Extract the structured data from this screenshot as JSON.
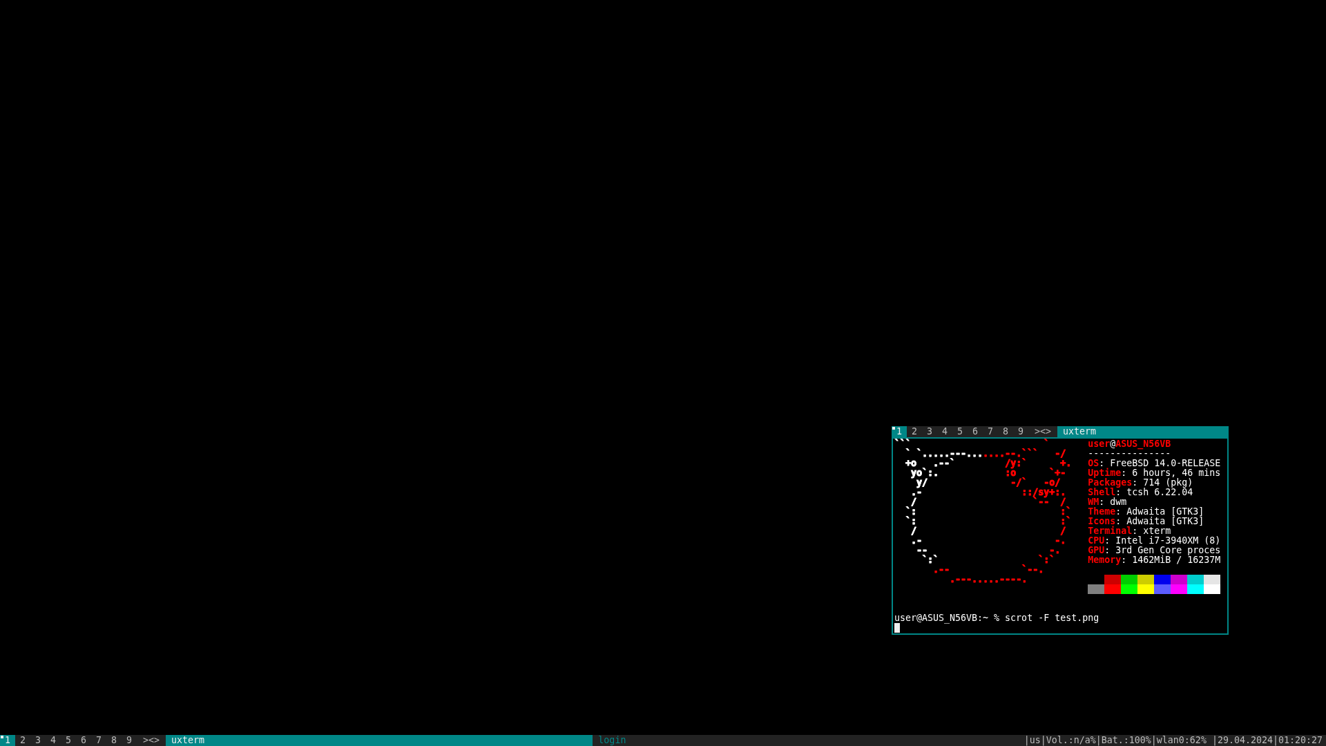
{
  "terminal_window": {
    "bar": {
      "tags": [
        {
          "label": "1",
          "selected": true,
          "occupied": true
        },
        {
          "label": "2",
          "selected": false,
          "occupied": false
        },
        {
          "label": "3",
          "selected": false,
          "occupied": false
        },
        {
          "label": "4",
          "selected": false,
          "occupied": false
        },
        {
          "label": "5",
          "selected": false,
          "occupied": false
        },
        {
          "label": "6",
          "selected": false,
          "occupied": false
        },
        {
          "label": "7",
          "selected": false,
          "occupied": false
        },
        {
          "label": "8",
          "selected": false,
          "occupied": false
        },
        {
          "label": "9",
          "selected": false,
          "occupied": false
        }
      ],
      "layout_symbol": "><>",
      "windows": [
        {
          "title": "uxterm",
          "selected": true,
          "hidden": false
        }
      ]
    },
    "logo": {
      "lines": [
        [
          {
            "text": "```",
            "color": "#ffffff"
          },
          {
            "text": "                        `",
            "color": "#ff0000"
          }
        ],
        [
          {
            "text": "  ` `.....---...",
            "color": "#ffffff"
          },
          {
            "text": "....--.```   -/",
            "color": "#ff0000"
          }
        ],
        [
          {
            "text": "  +o   .--`",
            "color": "#ffffff"
          },
          {
            "text": "         /y:`      +.",
            "color": "#ff0000"
          }
        ],
        [
          {
            "text": "   yo`:.",
            "color": "#ffffff"
          },
          {
            "text": "            :o      `+-",
            "color": "#ff0000"
          }
        ],
        [
          {
            "text": "    y/",
            "color": "#ffffff"
          },
          {
            "text": "               -/`   -o/",
            "color": "#ff0000"
          }
        ],
        [
          {
            "text": "   .-",
            "color": "#ffffff"
          },
          {
            "text": "                  ::/sy+:.",
            "color": "#ff0000"
          }
        ],
        [
          {
            "text": "   /",
            "color": "#ffffff"
          },
          {
            "text": "                     `--  /",
            "color": "#ff0000"
          }
        ],
        [
          {
            "text": "  `:",
            "color": "#ffffff"
          },
          {
            "text": "                          :`",
            "color": "#ff0000"
          }
        ],
        [
          {
            "text": "  `:",
            "color": "#ffffff"
          },
          {
            "text": "                          :`",
            "color": "#ff0000"
          }
        ],
        [
          {
            "text": "   /",
            "color": "#ffffff"
          },
          {
            "text": "                          /",
            "color": "#ff0000"
          }
        ],
        [
          {
            "text": "   .-",
            "color": "#ffffff"
          },
          {
            "text": "                        -.",
            "color": "#ff0000"
          }
        ],
        [
          {
            "text": "    --",
            "color": "#ffffff"
          },
          {
            "text": "                      -.",
            "color": "#ff0000"
          }
        ],
        [
          {
            "text": "     `:`",
            "color": "#ffffff"
          },
          {
            "text": "                  `:`",
            "color": "#ff0000"
          }
        ],
        [
          {
            "text": "       .--             `--.",
            "color": "#ff0000"
          }
        ],
        [
          {
            "text": "          .---.....----.",
            "color": "#ff0000"
          }
        ]
      ]
    },
    "info": {
      "user": "user",
      "at": "@",
      "host": "ASUS_N56VB",
      "underline": "---------------",
      "fields": [
        {
          "label": "OS",
          "separator": ":",
          "value": "FreeBSD 14.0-RELEASE"
        },
        {
          "label": "Uptime",
          "separator": ":",
          "value": "6 hours, 46 mins"
        },
        {
          "label": "Packages",
          "separator": ":",
          "value": "714 (pkg)"
        },
        {
          "label": "Shell",
          "separator": ":",
          "value": "tcsh 6.22.04"
        },
        {
          "label": "WM",
          "separator": ":",
          "value": "dwm"
        },
        {
          "label": "Theme",
          "separator": ":",
          "value": "Adwaita [GTK3]"
        },
        {
          "label": "Icons",
          "separator": ":",
          "value": "Adwaita [GTK3]"
        },
        {
          "label": "Terminal",
          "separator": ":",
          "value": "xterm"
        },
        {
          "label": "CPU",
          "separator": ":",
          "value": "Intel i7-3940XM (8)"
        },
        {
          "label": "GPU",
          "separator": ":",
          "value": "3rd Gen Core proces"
        },
        {
          "label": "Memory",
          "separator": ":",
          "value": "1462MiB / 16237M"
        }
      ]
    },
    "palette": {
      "rows": [
        [
          {
            "color": "#cd0000"
          },
          {
            "color": "#00cd00"
          },
          {
            "color": "#cdcd00"
          },
          {
            "color": "#0000ee"
          },
          {
            "color": "#cd00cd"
          },
          {
            "color": "#00cdcd"
          },
          {
            "color": "#e5e5e5"
          }
        ],
        [
          {
            "color": "#7f7f7f"
          },
          {
            "color": "#ff0000"
          },
          {
            "color": "#00ff00"
          },
          {
            "color": "#ffff00"
          },
          {
            "color": "#5c5cff"
          },
          {
            "color": "#ff00ff"
          },
          {
            "color": "#00ffff"
          },
          {
            "color": "#ffffff"
          }
        ]
      ]
    },
    "prompt": "user@ASUS_N56VB:~ % scrot -F test.png"
  },
  "bar": {
    "tags": [
      {
        "label": "1",
        "selected": true,
        "occupied": true
      },
      {
        "label": "2",
        "selected": false,
        "occupied": false
      },
      {
        "label": "3",
        "selected": false,
        "occupied": false
      },
      {
        "label": "4",
        "selected": false,
        "occupied": false
      },
      {
        "label": "5",
        "selected": false,
        "occupied": false
      },
      {
        "label": "6",
        "selected": false,
        "occupied": false
      },
      {
        "label": "7",
        "selected": false,
        "occupied": false
      },
      {
        "label": "8",
        "selected": false,
        "occupied": false
      },
      {
        "label": "9",
        "selected": false,
        "occupied": false
      }
    ],
    "layout_symbol": "><>",
    "windows": [
      {
        "title": "uxterm",
        "selected": true,
        "hidden": false
      },
      {
        "title": "login",
        "selected": false,
        "hidden": true
      }
    ],
    "status": "|us|Vol.:n/a%|Bat.:100%|wlan0:62% |29.04.2024|01:20:27"
  }
}
